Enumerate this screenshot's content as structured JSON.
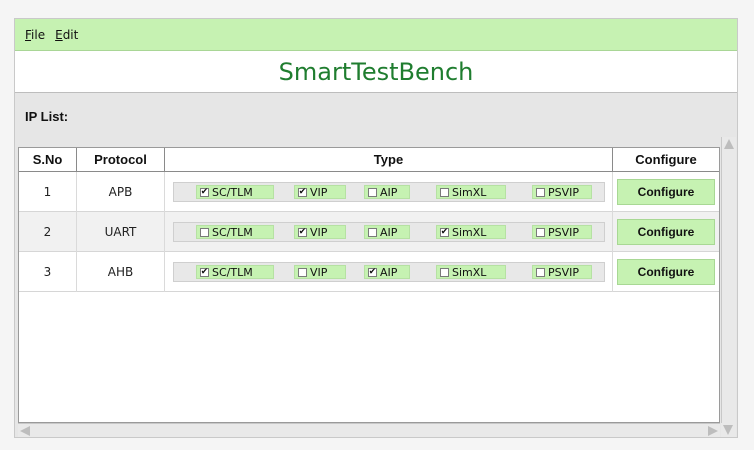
{
  "menu": [
    {
      "mnemonic": "F",
      "rest": "ile"
    },
    {
      "mnemonic": "E",
      "rest": "dit"
    }
  ],
  "app_title": "SmartTestBench",
  "ip_list_label": "IP List:",
  "table": {
    "headers": [
      "S.No",
      "Protocol",
      "Type",
      "Configure"
    ],
    "type_names": [
      "SC/TLM",
      "VIP",
      "AIP",
      "SimXL",
      "PSVIP"
    ],
    "rows": [
      {
        "sno": "1",
        "protocol": "APB",
        "checked": [
          true,
          true,
          false,
          false,
          false
        ],
        "configure_label": "Configure"
      },
      {
        "sno": "2",
        "protocol": "UART",
        "checked": [
          false,
          true,
          false,
          true,
          false
        ],
        "configure_label": "Configure"
      },
      {
        "sno": "3",
        "protocol": "AHB",
        "checked": [
          true,
          false,
          true,
          false,
          false
        ],
        "configure_label": "Configure"
      }
    ]
  },
  "colors": {
    "accent_green": "#c6f2b2",
    "title_green": "#1f7d2f"
  }
}
